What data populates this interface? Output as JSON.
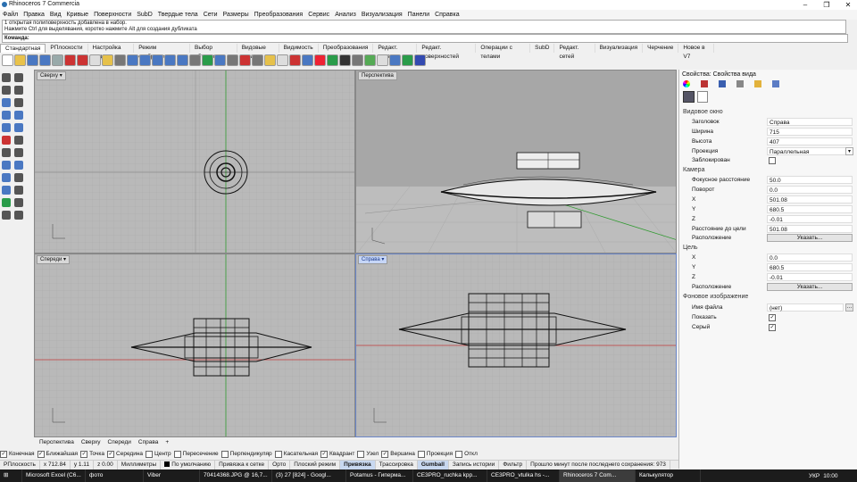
{
  "window": {
    "title": "Rhinoceros 7 Commercia"
  },
  "menu": [
    "Файл",
    "Правка",
    "Вид",
    "Кривые",
    "Поверхности",
    "SubD",
    "Твердые тела",
    "Сети",
    "Размеры",
    "Преобразования",
    "Сервис",
    "Анализ",
    "Визуализация",
    "Панели",
    "Справка"
  ],
  "command": {
    "history": [
      "1 открытая полиповерхность добавлена в набор.",
      "Нажмите Ctrl для выделявания, коротко нажмите Alt для создания дубликата"
    ],
    "prompt": "Команда:"
  },
  "toolbar_tabs": [
    "Стандартная",
    "РПлоскости",
    "Настройка вида",
    "Режим отображения",
    "Выбор объектов",
    "Видовые окна",
    "Видимость",
    "Преобразования",
    "Редакт. кривых",
    "Редакт. поверхностей",
    "Операции с телами",
    "SubD",
    "Редакт. сетей",
    "Визуализация",
    "Черчение",
    "Новое в V7"
  ],
  "viewports": {
    "top": "Сверху",
    "perspective": "Перспектива",
    "front": "Спереди",
    "right": "Справа"
  },
  "viewport_tabs": [
    "Перспектива",
    "Сверху",
    "Спереди",
    "Справа"
  ],
  "osnap": [
    {
      "label": "Конечная",
      "checked": true
    },
    {
      "label": "Ближайшая",
      "checked": true
    },
    {
      "label": "Точка",
      "checked": true
    },
    {
      "label": "Середина",
      "checked": true
    },
    {
      "label": "Центр",
      "checked": false
    },
    {
      "label": "Пересечение",
      "checked": false
    },
    {
      "label": "Перпендикуляр",
      "checked": false
    },
    {
      "label": "Касательная",
      "checked": false
    },
    {
      "label": "Квадрант",
      "checked": true
    },
    {
      "label": "Узел",
      "checked": false
    },
    {
      "label": "Вершина",
      "checked": true
    },
    {
      "label": "Проекция",
      "checked": false
    },
    {
      "label": "Откл",
      "checked": false
    }
  ],
  "status": {
    "cplane": "РПлоскость",
    "x": "x 712.84",
    "y": "y 1.11",
    "z": "z 0.00",
    "units": "Миллиметры",
    "layer": "По умолчанию",
    "grid_snap": "Привязка к сетке",
    "ortho": "Орто",
    "planar": "Плоский режим",
    "osnap": "Привязка",
    "smarttrack": "Трассировка",
    "gumball": "Gumball",
    "history": "Запись истории",
    "filter": "Фильтр",
    "saved": "Прошло минут после последнего сохранения: 973"
  },
  "taskbar": [
    "Microsoft Excel (C6...",
    "фото",
    "Viber",
    "70414368.JPG @ 16,7...",
    "(3) 27 [824] - Googl...",
    "Potamus - Гиперма...",
    "CE3PRO_ruchka kpp...",
    "CE3PRO_vtulka hs -...",
    "Rhinoceros 7 Com...",
    "Калькулятор"
  ],
  "tray": {
    "lang": "УКР",
    "time": "10:00"
  },
  "panel": {
    "title": "Свойства: Свойства вида",
    "viewport_section": "Видовое окно",
    "viewport": [
      {
        "label": "Заголовок",
        "value": "Справа"
      },
      {
        "label": "Ширина",
        "value": "715"
      },
      {
        "label": "Высота",
        "value": "407"
      },
      {
        "label": "Проекция",
        "value": "Параллельная"
      }
    ],
    "locked_label": "Заблокирован",
    "camera_section": "Камера",
    "camera": [
      {
        "label": "Фокусное расстояние",
        "value": "50.0"
      },
      {
        "label": "Поворот",
        "value": "0.0"
      },
      {
        "label": "X",
        "value": "501.08"
      },
      {
        "label": "Y",
        "value": "680.5"
      },
      {
        "label": "Z",
        "value": "-0.01"
      },
      {
        "label": "Расстояние до цели",
        "value": "501.08"
      }
    ],
    "location_label": "Расположение",
    "pick_button": "Указать...",
    "target_section": "Цель",
    "target": [
      {
        "label": "X",
        "value": "0.0"
      },
      {
        "label": "Y",
        "value": "680.5"
      },
      {
        "label": "Z",
        "value": "-0.01"
      }
    ],
    "bg_section": "Фоновое изображение",
    "filename_label": "Имя файла",
    "filename_value": "(нет)",
    "show_label": "Показать",
    "gray_label": "Серый"
  }
}
